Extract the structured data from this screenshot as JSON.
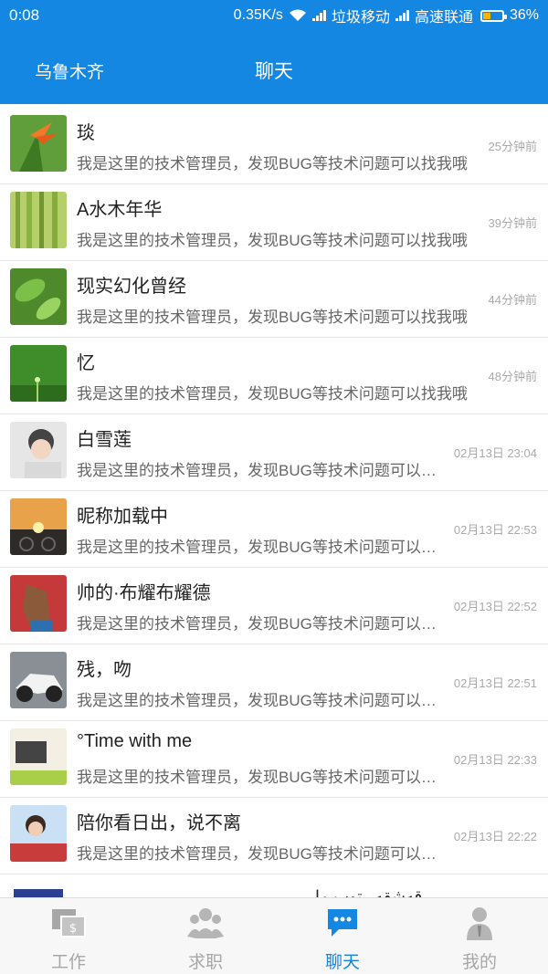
{
  "status_bar": {
    "time": "0:08",
    "speed": "0.35K/s",
    "carrier1": "垃圾移动",
    "carrier2": "高速联通",
    "battery": "36%",
    "battery_level": 0.36
  },
  "header": {
    "city": "乌鲁木齐",
    "title": "聊天"
  },
  "chats": [
    {
      "name": "琰",
      "message": "我是这里的技术管理员，发现BUG等技术问题可以找我哦",
      "time": "25分钟前"
    },
    {
      "name": "A水木年华",
      "message": "我是这里的技术管理员，发现BUG等技术问题可以找我哦",
      "time": "39分钟前"
    },
    {
      "name": "现实幻化曾经",
      "message": "我是这里的技术管理员，发现BUG等技术问题可以找我哦",
      "time": "44分钟前"
    },
    {
      "name": "忆",
      "message": "我是这里的技术管理员，发现BUG等技术问题可以找我哦",
      "time": "48分钟前"
    },
    {
      "name": "白雪莲",
      "message": "我是这里的技术管理员，发现BUG等技术问题可以找我哦",
      "time": "02月13日 23:04"
    },
    {
      "name": "昵称加载中",
      "message": "我是这里的技术管理员，发现BUG等技术问题可以找我哦",
      "time": "02月13日 22:53"
    },
    {
      "name": "帅的·布耀布耀德",
      "message": "我是这里的技术管理员，发现BUG等技术问题可以找我哦",
      "time": "02月13日 22:52"
    },
    {
      "name": "残，吻",
      "message": "我是这里的技术管理员，发现BUG等技术问题可以找我哦",
      "time": "02月13日 22:51"
    },
    {
      "name": "°Time with me",
      "message": "我是这里的技术管理员，发现BUG等技术问题可以找我哦",
      "time": "02月13日 22:33"
    },
    {
      "name": "陪你看日出，说不离",
      "message": "我是这里的技术管理员，发现BUG等技术问题可以找我哦",
      "time": "02月13日 22:22"
    },
    {
      "name": "قەشقەر توپ ما"
    }
  ],
  "nav": {
    "work": "工作",
    "jobs": "求职",
    "chat": "聊天",
    "mine": "我的"
  },
  "colors": {
    "primary": "#1487e3",
    "nav_inactive": "#a7a7a7"
  }
}
